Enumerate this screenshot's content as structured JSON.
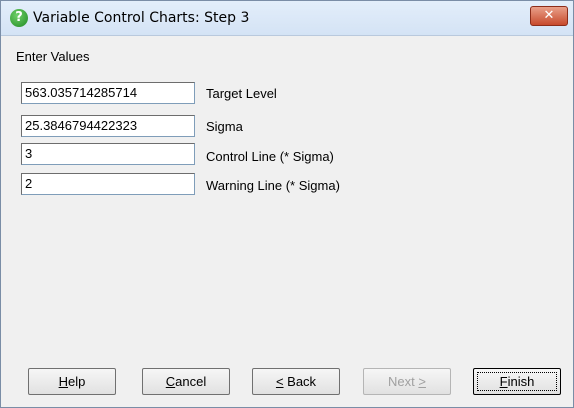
{
  "window": {
    "title": "Variable Control Charts: Step 3",
    "close_glyph": "✕"
  },
  "section": {
    "heading": "Enter Values"
  },
  "fields": [
    {
      "value": "563.035714285714",
      "label": "Target Level"
    },
    {
      "value": "25.3846794422323",
      "label": "Sigma"
    },
    {
      "value": "3",
      "label": "Control Line (* Sigma)"
    },
    {
      "value": "2",
      "label": "Warning Line (* Sigma)"
    }
  ],
  "buttons": {
    "help": {
      "mnemonic": "H",
      "rest": "elp"
    },
    "cancel": {
      "mnemonic": "C",
      "rest": "ancel"
    },
    "back": {
      "mnemonic": "<",
      "rest": " Back"
    },
    "next": {
      "pre": "Next ",
      "mnemonic": ">",
      "enabled": false
    },
    "finish": {
      "mnemonic": "F",
      "rest": "inish"
    }
  },
  "colors": {
    "title_bar": "#d4e3f5",
    "close_button": "#c74a2c",
    "dialog_bg": "#f0f0f0"
  },
  "icons": {
    "app_icon": "question-icon"
  }
}
